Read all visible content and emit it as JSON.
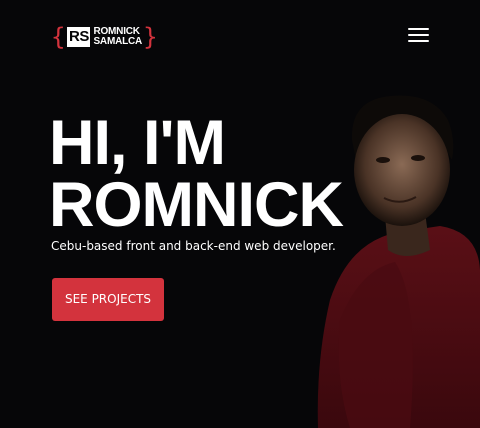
{
  "header": {
    "logo_monogram": "RS",
    "logo_line1": "ROMNICK",
    "logo_line2": "SAMALCA",
    "brace_left": "{",
    "brace_right": "}",
    "menu_icon": "hamburger-menu-icon"
  },
  "hero": {
    "headline_line1": "HI, I'M",
    "headline_line2": "ROMNICK",
    "tagline": "Cebu-based front and back-end web developer.",
    "cta_label": "SEE PROJECTS"
  },
  "colors": {
    "background": "#060608",
    "accent": "#d3333d",
    "text": "#ffffff"
  }
}
